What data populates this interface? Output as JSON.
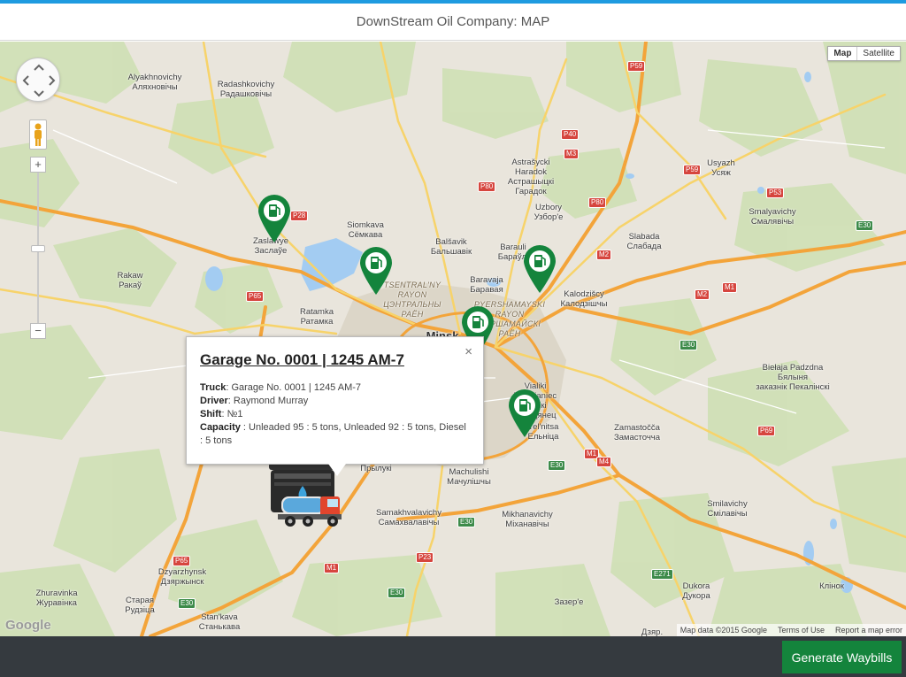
{
  "header": {
    "title": "DownStream Oil Company: MAP"
  },
  "map": {
    "type_control": {
      "map_label": "Map",
      "satellite_label": "Satellite"
    },
    "zoom": {
      "plus": "+",
      "minus": "−",
      "tick": "−"
    },
    "logo": "Google",
    "attribution": {
      "data": "Map data ©2015 Google",
      "terms": "Terms of Use",
      "report": "Report a map error"
    },
    "places": [
      {
        "name": "Alyakhnovichy\nАляхновічы",
        "style": ""
      },
      {
        "name": "Radashkovichy\nРадашковічы",
        "style": ""
      },
      {
        "name": "Zaslawye\nЗаслаўе",
        "style": ""
      },
      {
        "name": "Siomkava\nСёмкава",
        "style": ""
      },
      {
        "name": "Balšavik\nБальшавік",
        "style": ""
      },
      {
        "name": "Astrašycki\nHaradok\nАстрашыцкі\nГарадок",
        "style": ""
      },
      {
        "name": "Uzbory\nУзбор'е",
        "style": ""
      },
      {
        "name": "Usyazh\nУсяж",
        "style": ""
      },
      {
        "name": "Smalyavichy\nСмалявічы",
        "style": ""
      },
      {
        "name": "Slabada\nСлабада",
        "style": ""
      },
      {
        "name": "Barauli\nБараўлі",
        "style": ""
      },
      {
        "name": "Baravaja\nБаравая",
        "style": ""
      },
      {
        "name": "Rakaw\nРакаў",
        "style": ""
      },
      {
        "name": "Ratamka\nРатамка",
        "style": ""
      },
      {
        "name": "TSENTRAL'NY\nRAYON\nЦЭНТРАЛЬНЫ\nРАЁН",
        "style": "district"
      },
      {
        "name": "PYERSHAMAYSKI\nRAYON\nПЕРШАМАЙСКІ\nРАЁН",
        "style": "district"
      },
      {
        "name": "Kalodzišcy\nКалодзішчы",
        "style": ""
      },
      {
        "name": "Minsk",
        "style": "big"
      },
      {
        "name": "Vialiki\nTraścianiec\nВялікі\nТрасцянец",
        "style": ""
      },
      {
        "name": "Biełaja Padzdna\nБялыня\nзаказнік Пекалінскі",
        "style": ""
      },
      {
        "name": "Yel'nitsa\nЕльніца",
        "style": ""
      },
      {
        "name": "Zamastočča\nЗамасточча",
        "style": ""
      },
      {
        "name": "Machulishi\nМачулішчы",
        "style": ""
      },
      {
        "name": "Прылукі",
        "style": ""
      },
      {
        "name": "Samakhvalavichy\nСамахвалавічы",
        "style": ""
      },
      {
        "name": "Mikhanavichy\nМіханавічы",
        "style": ""
      },
      {
        "name": "Smilavichy\nСмілавічы",
        "style": ""
      },
      {
        "name": "Dzyarzhynsk\nДзяржынск",
        "style": ""
      },
      {
        "name": "Zhuravinka\nЖуравінка",
        "style": ""
      },
      {
        "name": "Старая\nРудзіца",
        "style": ""
      },
      {
        "name": "Stan'kava\nСтанькава",
        "style": ""
      },
      {
        "name": "Dukora\nДукора",
        "style": ""
      },
      {
        "name": "Клінок",
        "style": ""
      },
      {
        "name": "Зазер'е",
        "style": ""
      },
      {
        "name": "Дзяр.",
        "style": ""
      }
    ],
    "road_shields": [
      "P59",
      "P40",
      "M3",
      "P80",
      "P59",
      "P53",
      "P80",
      "E30",
      "P28",
      "M2",
      "M1",
      "M2",
      "E30",
      "E30",
      "P65",
      "M1",
      "M4",
      "E30",
      "E30",
      "P23",
      "P65",
      "M1",
      "E30",
      "E271",
      "P69"
    ],
    "markers": [
      "fuel-station",
      "fuel-station",
      "fuel-station",
      "fuel-station",
      "fuel-station"
    ],
    "popup": {
      "title": "Garage No. 0001 | 1245 AM-7",
      "truck_label": "Truck",
      "truck_value": ": Garage No. 0001 | 1245 AM-7",
      "driver_label": "Driver",
      "driver_value": ": Raymond Murray",
      "shift_label": "Shift",
      "shift_value": ": №1",
      "capacity_label": "Capacity",
      "capacity_value": " : Unleaded 95 : 5 tons, Unleaded 92 : 5 tons, Diesel : 5 tons",
      "close": "×"
    }
  },
  "footer": {
    "generate_label": "Generate Waybills"
  },
  "colors": {
    "accent": "#1e9be0",
    "marker": "#14843c",
    "footer": "#353a3f",
    "highway": "#f3a43a"
  }
}
